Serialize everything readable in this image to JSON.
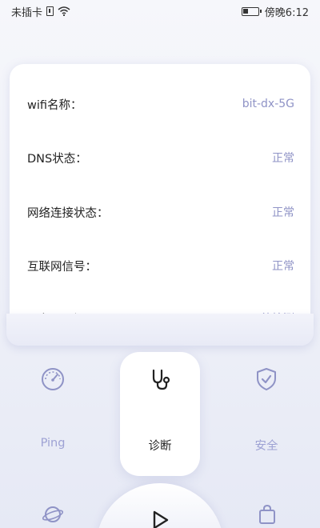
{
  "status_bar": {
    "carrier": "未插卡",
    "time": "傍晚6:12"
  },
  "info": {
    "rows": [
      {
        "label": "wifi名称：",
        "value": "bit-dx-5G"
      },
      {
        "label": "DNS状态：",
        "value": "正常"
      },
      {
        "label": "网络连接状态：",
        "value": "正常"
      },
      {
        "label": "互联网信号：",
        "value": "正常"
      },
      {
        "label": "服务器通讯：",
        "value": "待检测"
      }
    ]
  },
  "nav": {
    "items": [
      {
        "label": "Ping",
        "icon": "speedometer-icon"
      },
      {
        "label": "诊断",
        "icon": "stethoscope-icon",
        "active": true
      },
      {
        "label": "安全",
        "icon": "shield-check-icon"
      }
    ]
  },
  "colors": {
    "accent": "#8f93c6",
    "inactive_label": "#9ea2d4",
    "background": "#f0f2f9"
  }
}
